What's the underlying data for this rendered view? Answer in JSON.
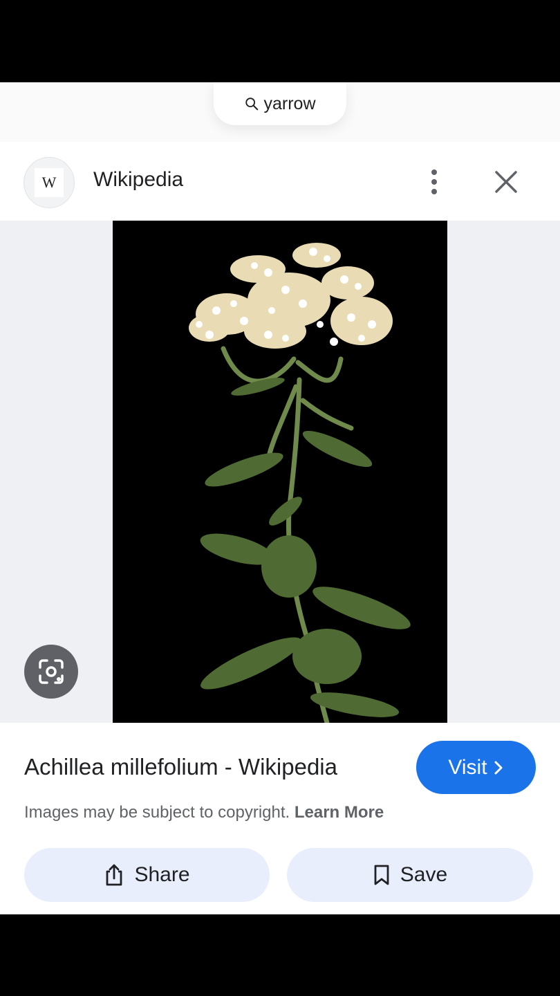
{
  "search": {
    "query": "yarrow",
    "icon": "search-icon"
  },
  "header": {
    "source_name": "Wikipedia",
    "favicon_letter": "W"
  },
  "result": {
    "title": "Achillea millefolium - Wikipedia",
    "visit_label": "Visit",
    "copyright_text": "Images may be subject to copyright.",
    "learn_more_label": "Learn More"
  },
  "actions": {
    "share_label": "Share",
    "save_label": "Save"
  },
  "colors": {
    "accent": "#1a73e8",
    "action_bg": "#e8eefb",
    "image_backdrop": "#eef0f3"
  }
}
